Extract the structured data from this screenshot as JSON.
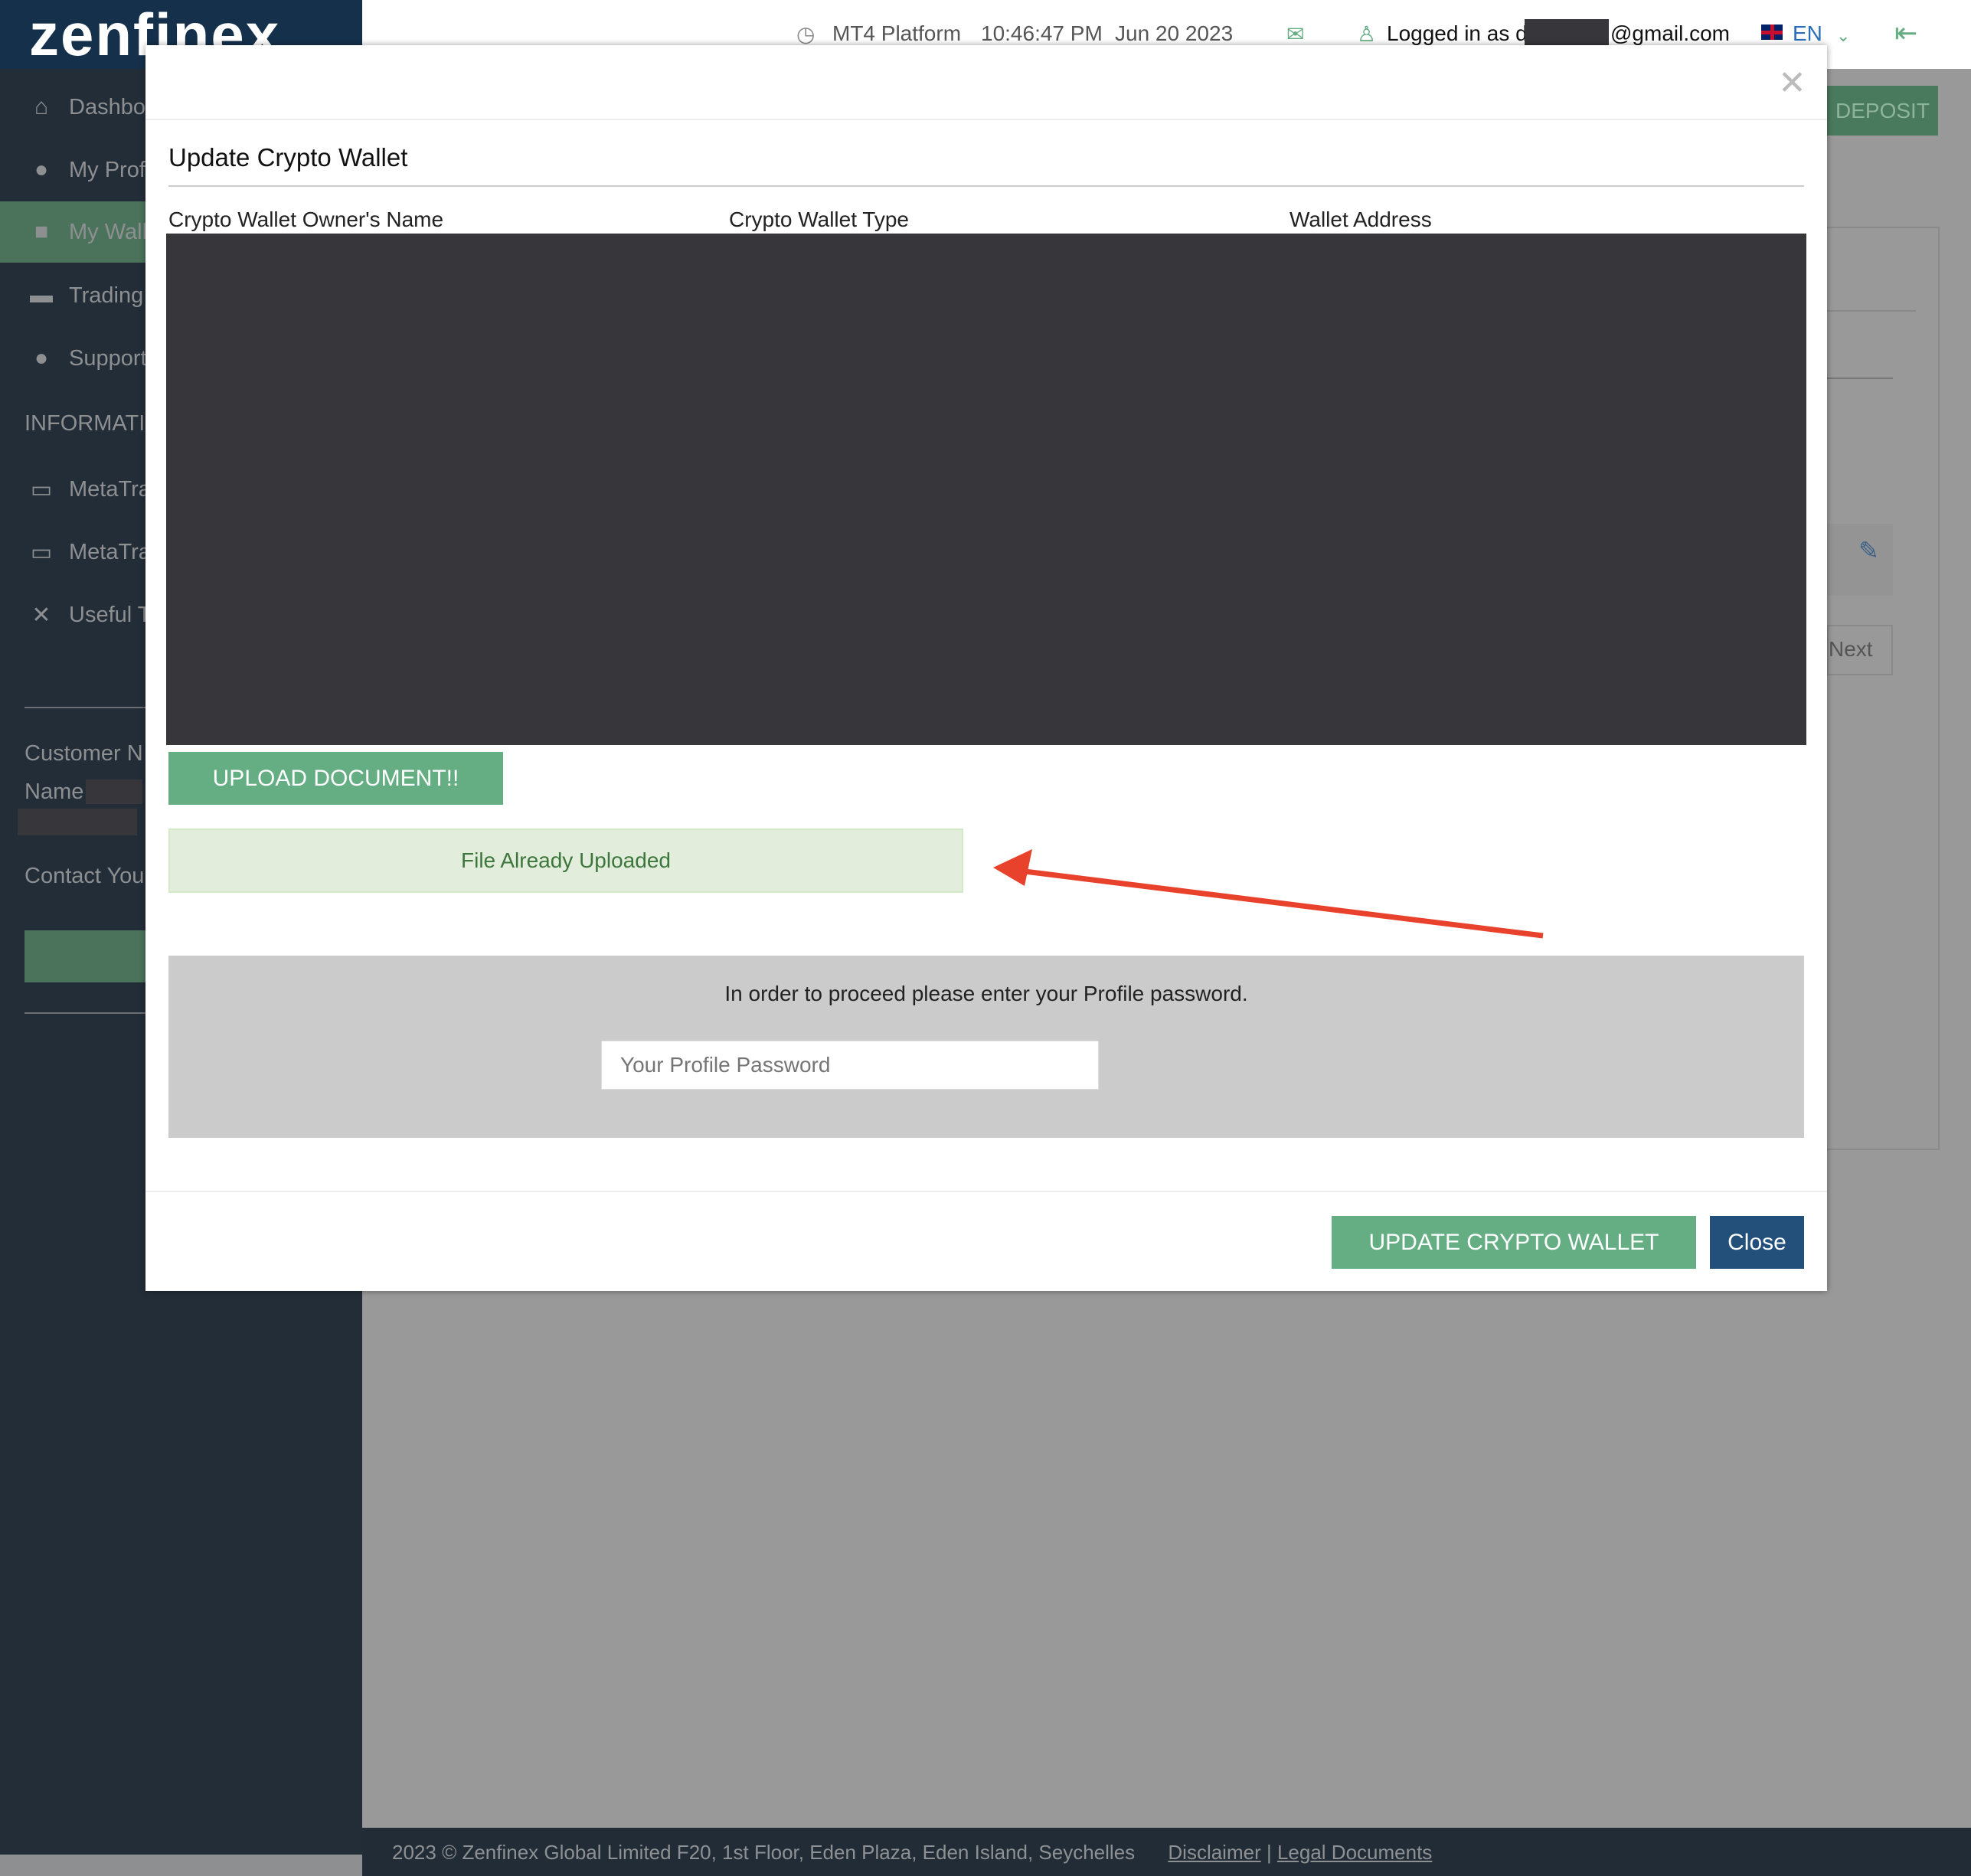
{
  "brand": {
    "logo_text": "zenfinex"
  },
  "header": {
    "platform": "MT4 Platform",
    "time": "10:46:47 PM",
    "date": "Jun 20 2023",
    "logged_in_prefix": "Logged in as d",
    "email_suffix": "@gmail.com",
    "language": "EN"
  },
  "sidebar": {
    "items": [
      {
        "label": "Dashbo",
        "icon": "home-icon"
      },
      {
        "label": "My Prof",
        "icon": "user-icon"
      },
      {
        "label": "My Wall",
        "icon": "folder-icon",
        "active": true
      },
      {
        "label": "Trading",
        "icon": "briefcase-icon"
      },
      {
        "label": "Support",
        "icon": "comments-icon"
      }
    ],
    "section_title": "INFORMATIO",
    "info_items": [
      {
        "label": "MetaTra",
        "icon": "laptop-icon"
      },
      {
        "label": "MetaTra",
        "icon": "laptop-icon"
      },
      {
        "label": "Useful T",
        "icon": "tools-icon"
      }
    ],
    "customer_label": "Customer N",
    "name_label": "Name",
    "contact_label": "Contact You"
  },
  "background": {
    "deposit_label": "DEPOSIT",
    "next_label": "Next"
  },
  "modal": {
    "title": "Update Crypto Wallet",
    "columns": [
      "Crypto Wallet Owner's Name",
      "Crypto Wallet Type",
      "Wallet Address"
    ],
    "upload_label": "UPLOAD DOCUMENT!!",
    "upload_status": "File Already Uploaded",
    "password_prompt": "In order to proceed please enter your Profile password.",
    "password_placeholder": "Your Profile Password",
    "password_value": "",
    "update_label": "UPDATE CRYPTO WALLET",
    "close_label": "Close"
  },
  "footer": {
    "copyright": "2023 © Zenfinex Global Limited F20, 1st Floor, Eden Plaza, Eden Island, Seychelles",
    "disclaimer": "Disclaimer",
    "separator": "|",
    "legal": "Legal Documents"
  },
  "colors": {
    "green": "#65ae84",
    "navy": "#22507a",
    "success_bg": "#e2eedb",
    "success_text": "#3c763d",
    "annotation_arrow": "#e8412c"
  }
}
